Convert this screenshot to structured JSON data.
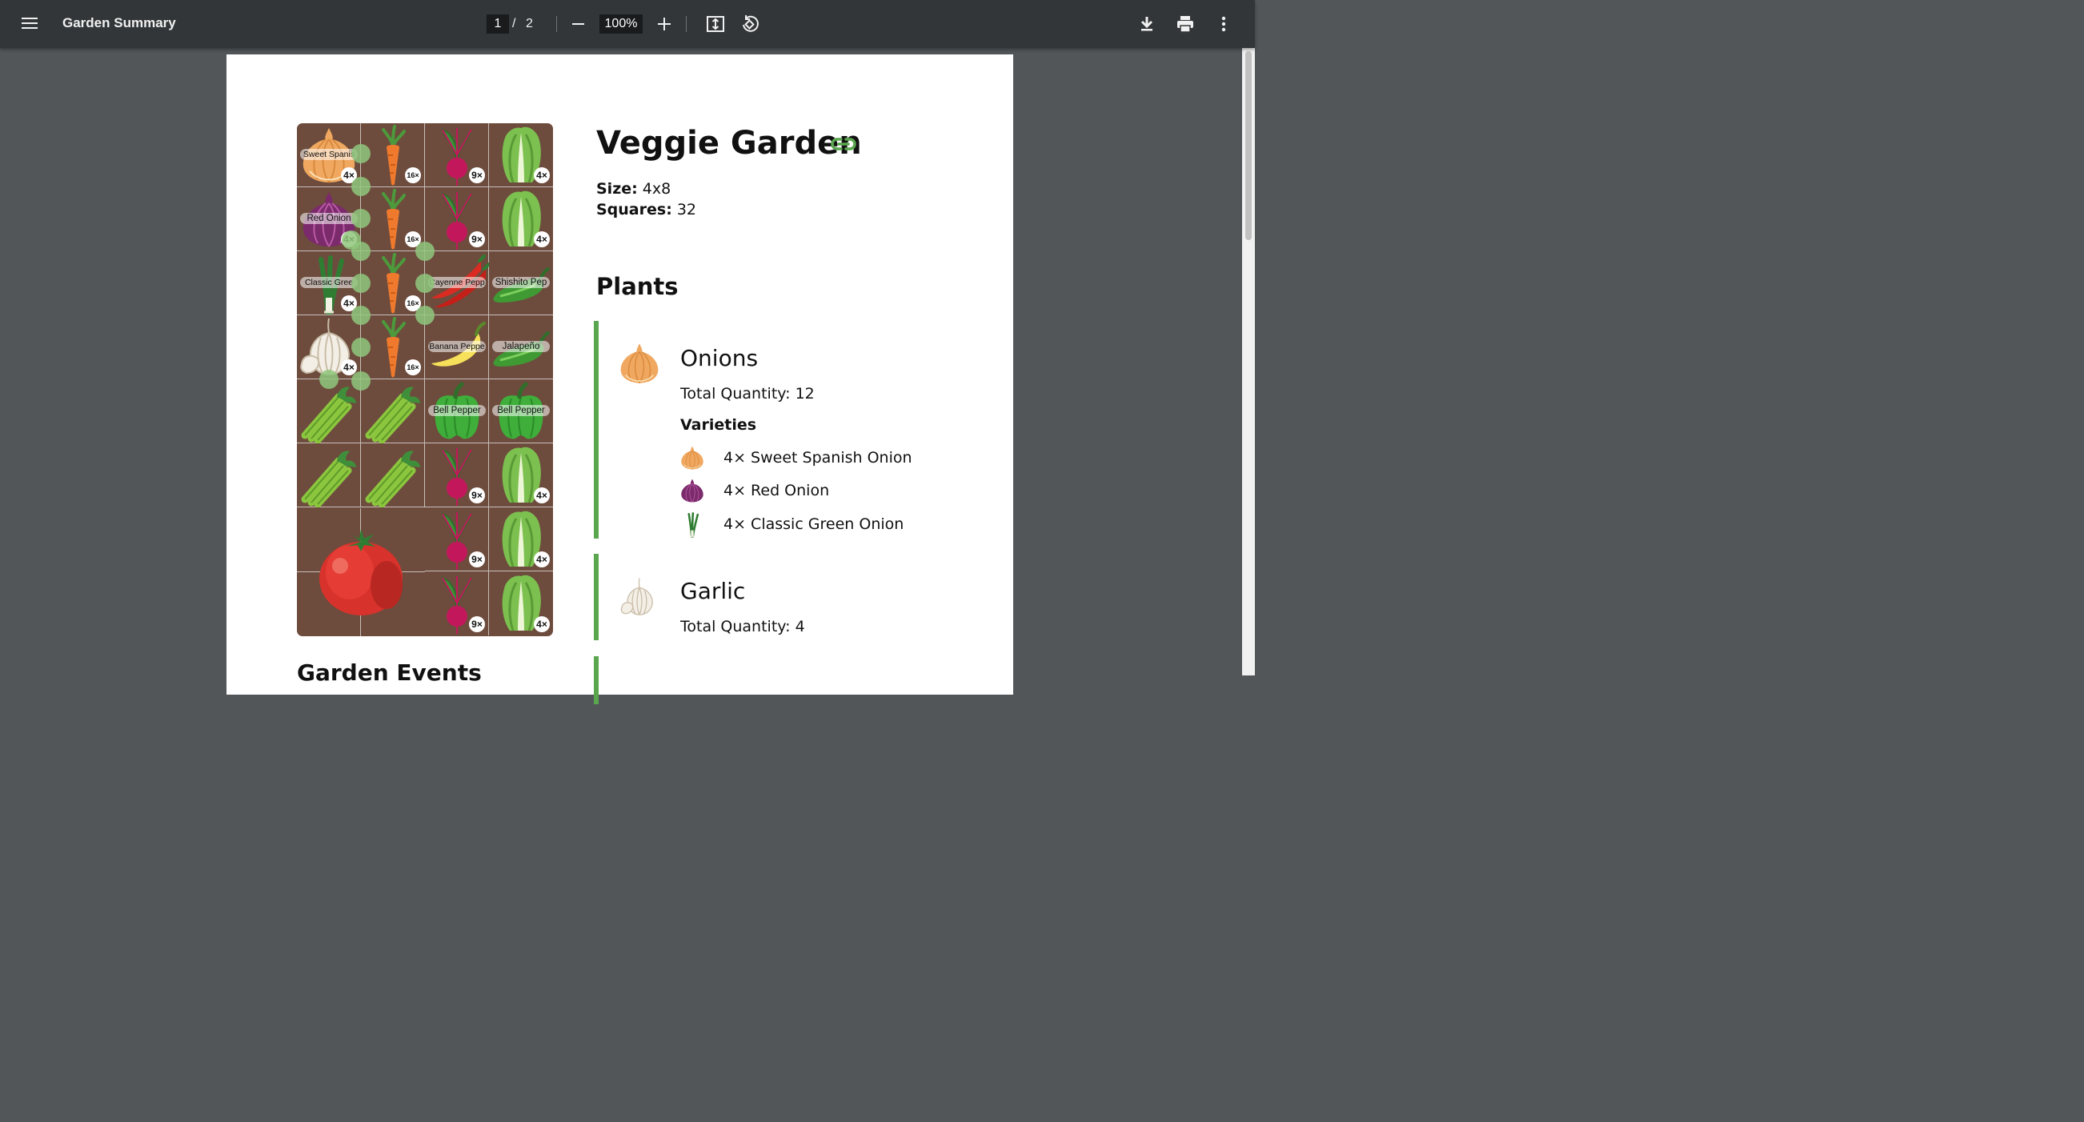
{
  "viewer": {
    "title": "Garden Summary",
    "current_page": "1",
    "page_separator": "/",
    "total_pages": "2",
    "zoom": "100%"
  },
  "icons": {
    "menu": "hamburger-menu-icon",
    "zoom_out": "minus-icon",
    "zoom_in": "plus-icon",
    "fit": "fit-to-page-icon",
    "rotate": "rotate-icon",
    "download": "download-icon",
    "print": "print-icon",
    "more": "more-vert-icon",
    "link": "link-icon"
  },
  "colors": {
    "toolbar": "#323639",
    "viewer_bg": "#525659",
    "accent_green": "#5aa64f",
    "soil": "#6d4c3d"
  },
  "garden": {
    "title": "Veggie Garden",
    "size_label": "Size:",
    "size_value": "4x8",
    "squares_label": "Squares:",
    "squares_value": "32"
  },
  "grid": {
    "labels": {
      "sweet_spanish": "Sweet Spanis",
      "red_onion": "Red Onion",
      "classic_green": "Classic Gree",
      "cayenne": "Cayenne Pepp",
      "shishito": "Shishito Pep",
      "banana": "Banana Peppe",
      "jalapeno": "Jalapeño",
      "bell_pepper": "Bell Pepper"
    },
    "badges": {
      "four": "4×",
      "nine": "9×",
      "sixteen": "16×"
    }
  },
  "plants_heading": "Plants",
  "plants": [
    {
      "name": "Onions",
      "total_quantity": "Total Quantity: 12",
      "varieties_heading": "Varieties",
      "varieties": [
        {
          "text": "4× Sweet Spanish Onion",
          "icon": "sweet-onion-icon"
        },
        {
          "text": "4× Red Onion",
          "icon": "red-onion-icon"
        },
        {
          "text": "4× Classic Green Onion",
          "icon": "green-onion-icon"
        }
      ]
    },
    {
      "name": "Garlic",
      "total_quantity": "Total Quantity: 4"
    }
  ],
  "events_heading": "Garden Events"
}
